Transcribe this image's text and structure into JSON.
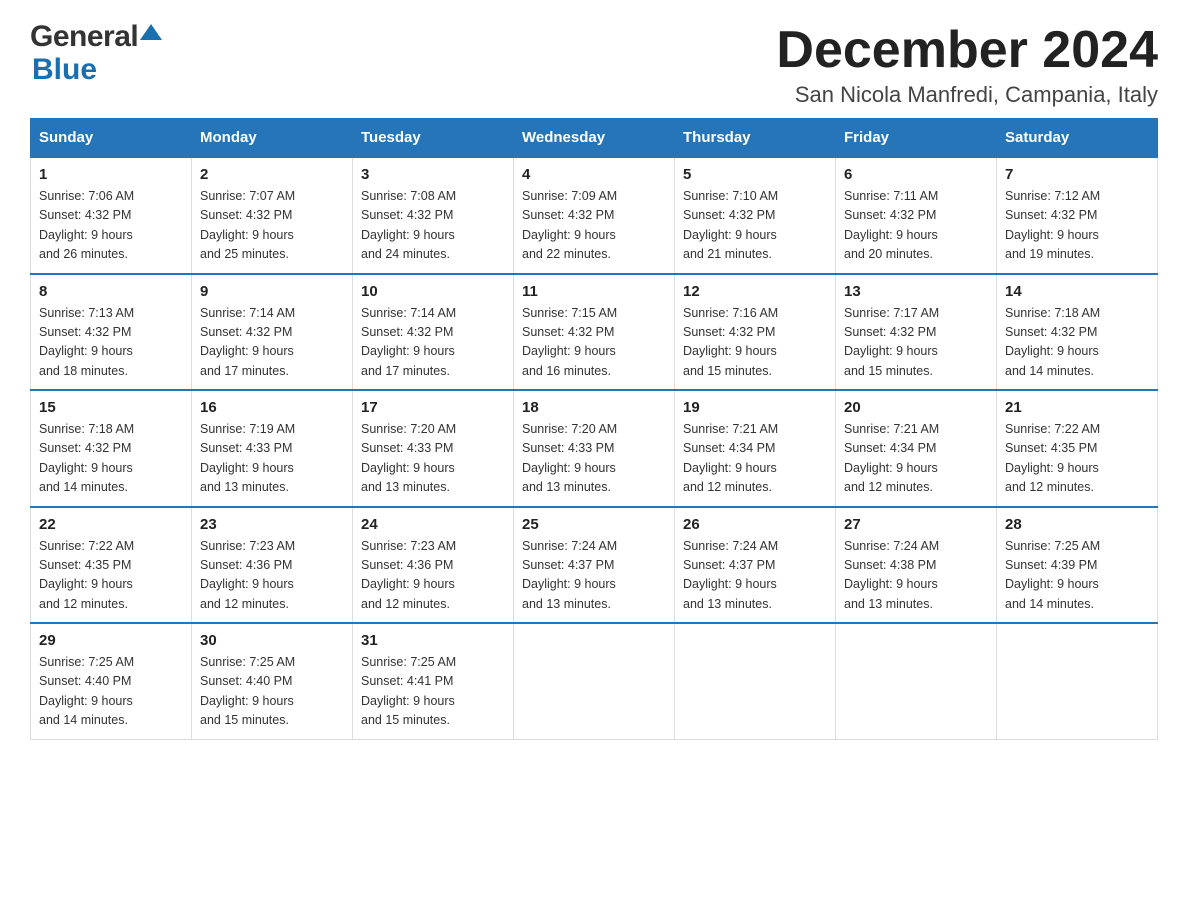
{
  "header": {
    "logo_general": "General",
    "logo_blue": "Blue",
    "month_title": "December 2024",
    "location": "San Nicola Manfredi, Campania, Italy"
  },
  "days_of_week": [
    "Sunday",
    "Monday",
    "Tuesday",
    "Wednesday",
    "Thursday",
    "Friday",
    "Saturday"
  ],
  "weeks": [
    [
      {
        "day": "1",
        "sunrise": "7:06 AM",
        "sunset": "4:32 PM",
        "daylight": "9 hours and 26 minutes."
      },
      {
        "day": "2",
        "sunrise": "7:07 AM",
        "sunset": "4:32 PM",
        "daylight": "9 hours and 25 minutes."
      },
      {
        "day": "3",
        "sunrise": "7:08 AM",
        "sunset": "4:32 PM",
        "daylight": "9 hours and 24 minutes."
      },
      {
        "day": "4",
        "sunrise": "7:09 AM",
        "sunset": "4:32 PM",
        "daylight": "9 hours and 22 minutes."
      },
      {
        "day": "5",
        "sunrise": "7:10 AM",
        "sunset": "4:32 PM",
        "daylight": "9 hours and 21 minutes."
      },
      {
        "day": "6",
        "sunrise": "7:11 AM",
        "sunset": "4:32 PM",
        "daylight": "9 hours and 20 minutes."
      },
      {
        "day": "7",
        "sunrise": "7:12 AM",
        "sunset": "4:32 PM",
        "daylight": "9 hours and 19 minutes."
      }
    ],
    [
      {
        "day": "8",
        "sunrise": "7:13 AM",
        "sunset": "4:32 PM",
        "daylight": "9 hours and 18 minutes."
      },
      {
        "day": "9",
        "sunrise": "7:14 AM",
        "sunset": "4:32 PM",
        "daylight": "9 hours and 17 minutes."
      },
      {
        "day": "10",
        "sunrise": "7:14 AM",
        "sunset": "4:32 PM",
        "daylight": "9 hours and 17 minutes."
      },
      {
        "day": "11",
        "sunrise": "7:15 AM",
        "sunset": "4:32 PM",
        "daylight": "9 hours and 16 minutes."
      },
      {
        "day": "12",
        "sunrise": "7:16 AM",
        "sunset": "4:32 PM",
        "daylight": "9 hours and 15 minutes."
      },
      {
        "day": "13",
        "sunrise": "7:17 AM",
        "sunset": "4:32 PM",
        "daylight": "9 hours and 15 minutes."
      },
      {
        "day": "14",
        "sunrise": "7:18 AM",
        "sunset": "4:32 PM",
        "daylight": "9 hours and 14 minutes."
      }
    ],
    [
      {
        "day": "15",
        "sunrise": "7:18 AM",
        "sunset": "4:32 PM",
        "daylight": "9 hours and 14 minutes."
      },
      {
        "day": "16",
        "sunrise": "7:19 AM",
        "sunset": "4:33 PM",
        "daylight": "9 hours and 13 minutes."
      },
      {
        "day": "17",
        "sunrise": "7:20 AM",
        "sunset": "4:33 PM",
        "daylight": "9 hours and 13 minutes."
      },
      {
        "day": "18",
        "sunrise": "7:20 AM",
        "sunset": "4:33 PM",
        "daylight": "9 hours and 13 minutes."
      },
      {
        "day": "19",
        "sunrise": "7:21 AM",
        "sunset": "4:34 PM",
        "daylight": "9 hours and 12 minutes."
      },
      {
        "day": "20",
        "sunrise": "7:21 AM",
        "sunset": "4:34 PM",
        "daylight": "9 hours and 12 minutes."
      },
      {
        "day": "21",
        "sunrise": "7:22 AM",
        "sunset": "4:35 PM",
        "daylight": "9 hours and 12 minutes."
      }
    ],
    [
      {
        "day": "22",
        "sunrise": "7:22 AM",
        "sunset": "4:35 PM",
        "daylight": "9 hours and 12 minutes."
      },
      {
        "day": "23",
        "sunrise": "7:23 AM",
        "sunset": "4:36 PM",
        "daylight": "9 hours and 12 minutes."
      },
      {
        "day": "24",
        "sunrise": "7:23 AM",
        "sunset": "4:36 PM",
        "daylight": "9 hours and 12 minutes."
      },
      {
        "day": "25",
        "sunrise": "7:24 AM",
        "sunset": "4:37 PM",
        "daylight": "9 hours and 13 minutes."
      },
      {
        "day": "26",
        "sunrise": "7:24 AM",
        "sunset": "4:37 PM",
        "daylight": "9 hours and 13 minutes."
      },
      {
        "day": "27",
        "sunrise": "7:24 AM",
        "sunset": "4:38 PM",
        "daylight": "9 hours and 13 minutes."
      },
      {
        "day": "28",
        "sunrise": "7:25 AM",
        "sunset": "4:39 PM",
        "daylight": "9 hours and 14 minutes."
      }
    ],
    [
      {
        "day": "29",
        "sunrise": "7:25 AM",
        "sunset": "4:40 PM",
        "daylight": "9 hours and 14 minutes."
      },
      {
        "day": "30",
        "sunrise": "7:25 AM",
        "sunset": "4:40 PM",
        "daylight": "9 hours and 15 minutes."
      },
      {
        "day": "31",
        "sunrise": "7:25 AM",
        "sunset": "4:41 PM",
        "daylight": "9 hours and 15 minutes."
      },
      null,
      null,
      null,
      null
    ]
  ],
  "labels": {
    "sunrise": "Sunrise: ",
    "sunset": "Sunset: ",
    "daylight": "Daylight: "
  }
}
